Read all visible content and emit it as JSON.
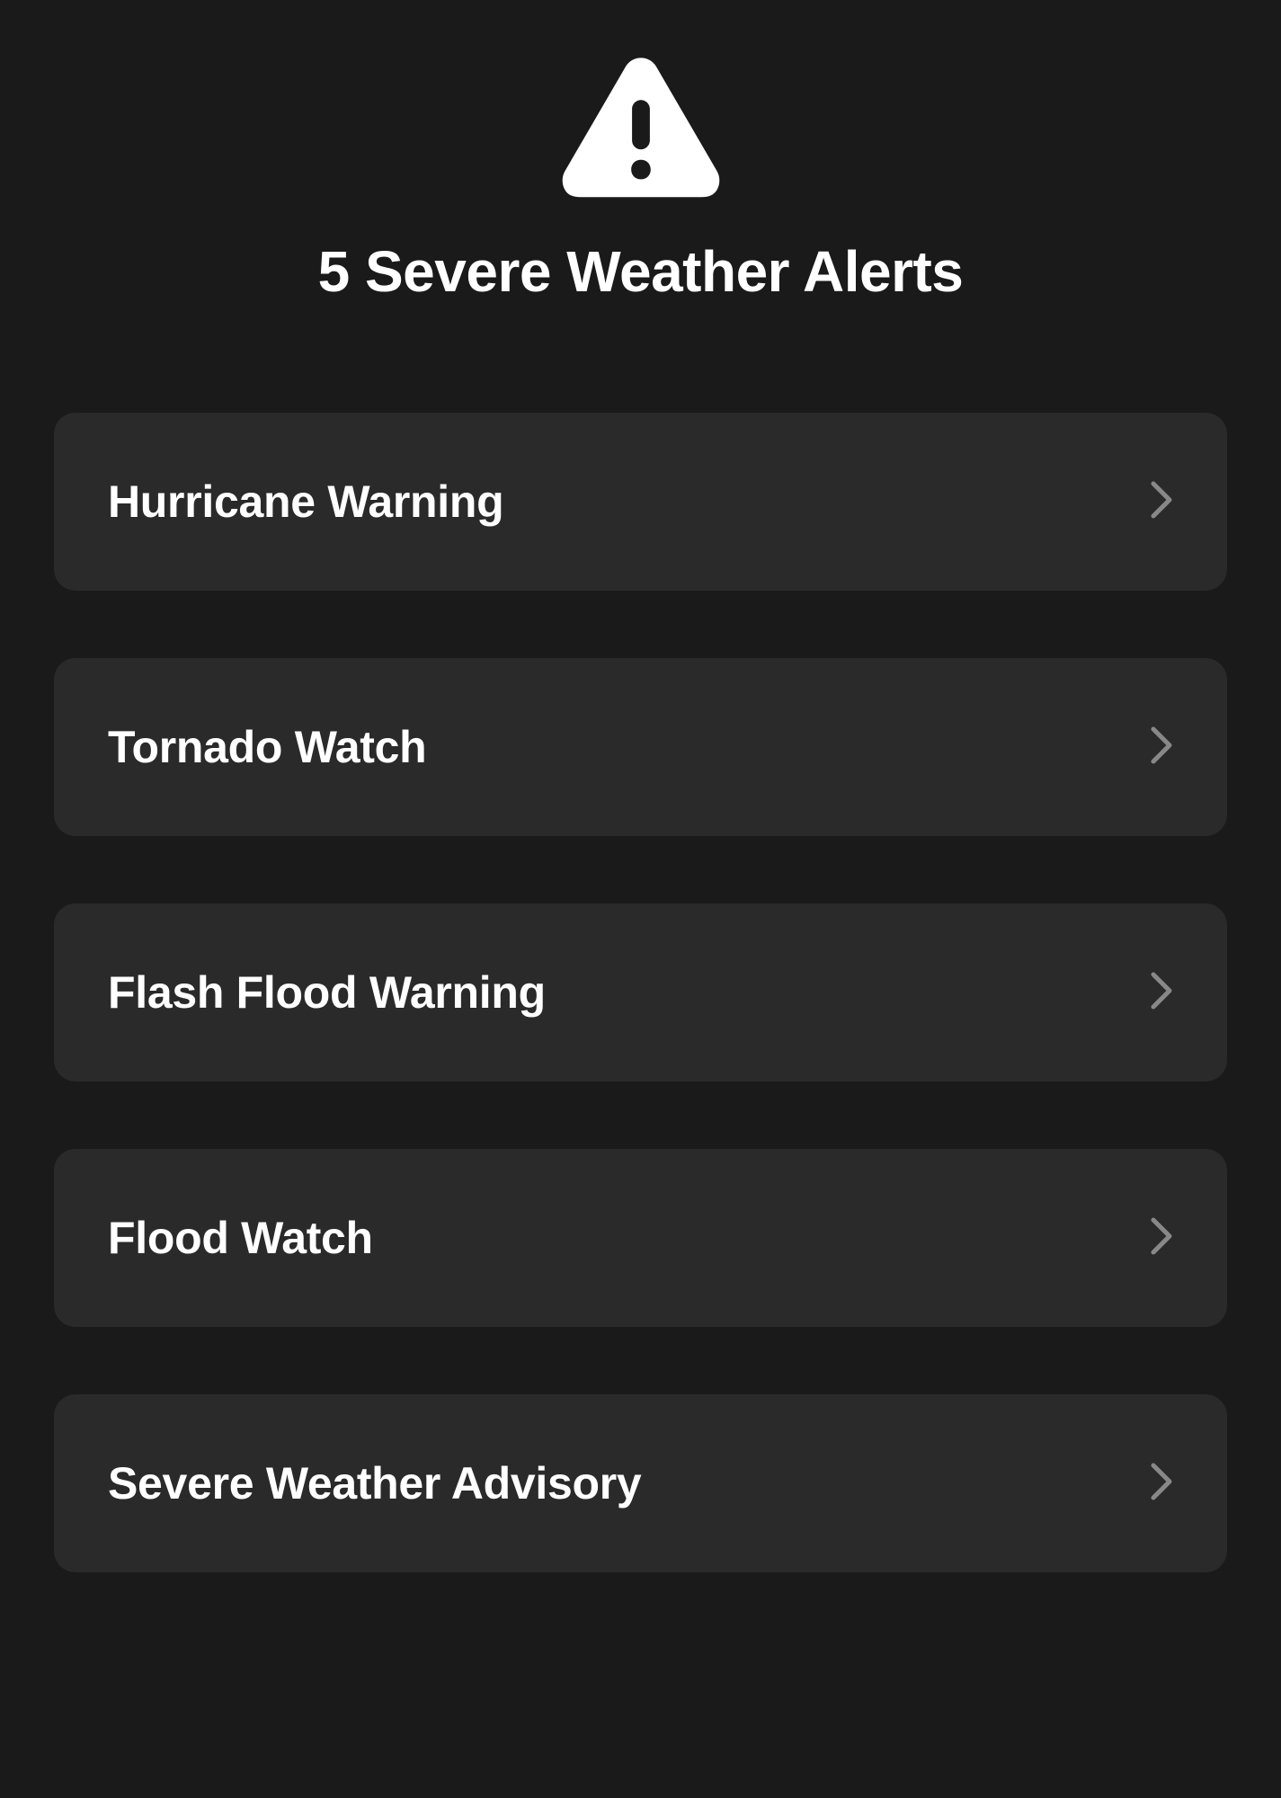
{
  "header": {
    "title": "5 Severe Weather Alerts"
  },
  "alerts": [
    {
      "label": "Hurricane Warning"
    },
    {
      "label": "Tornado Watch"
    },
    {
      "label": "Flash Flood Warning"
    },
    {
      "label": "Flood Watch"
    },
    {
      "label": "Severe Weather Advisory"
    }
  ]
}
